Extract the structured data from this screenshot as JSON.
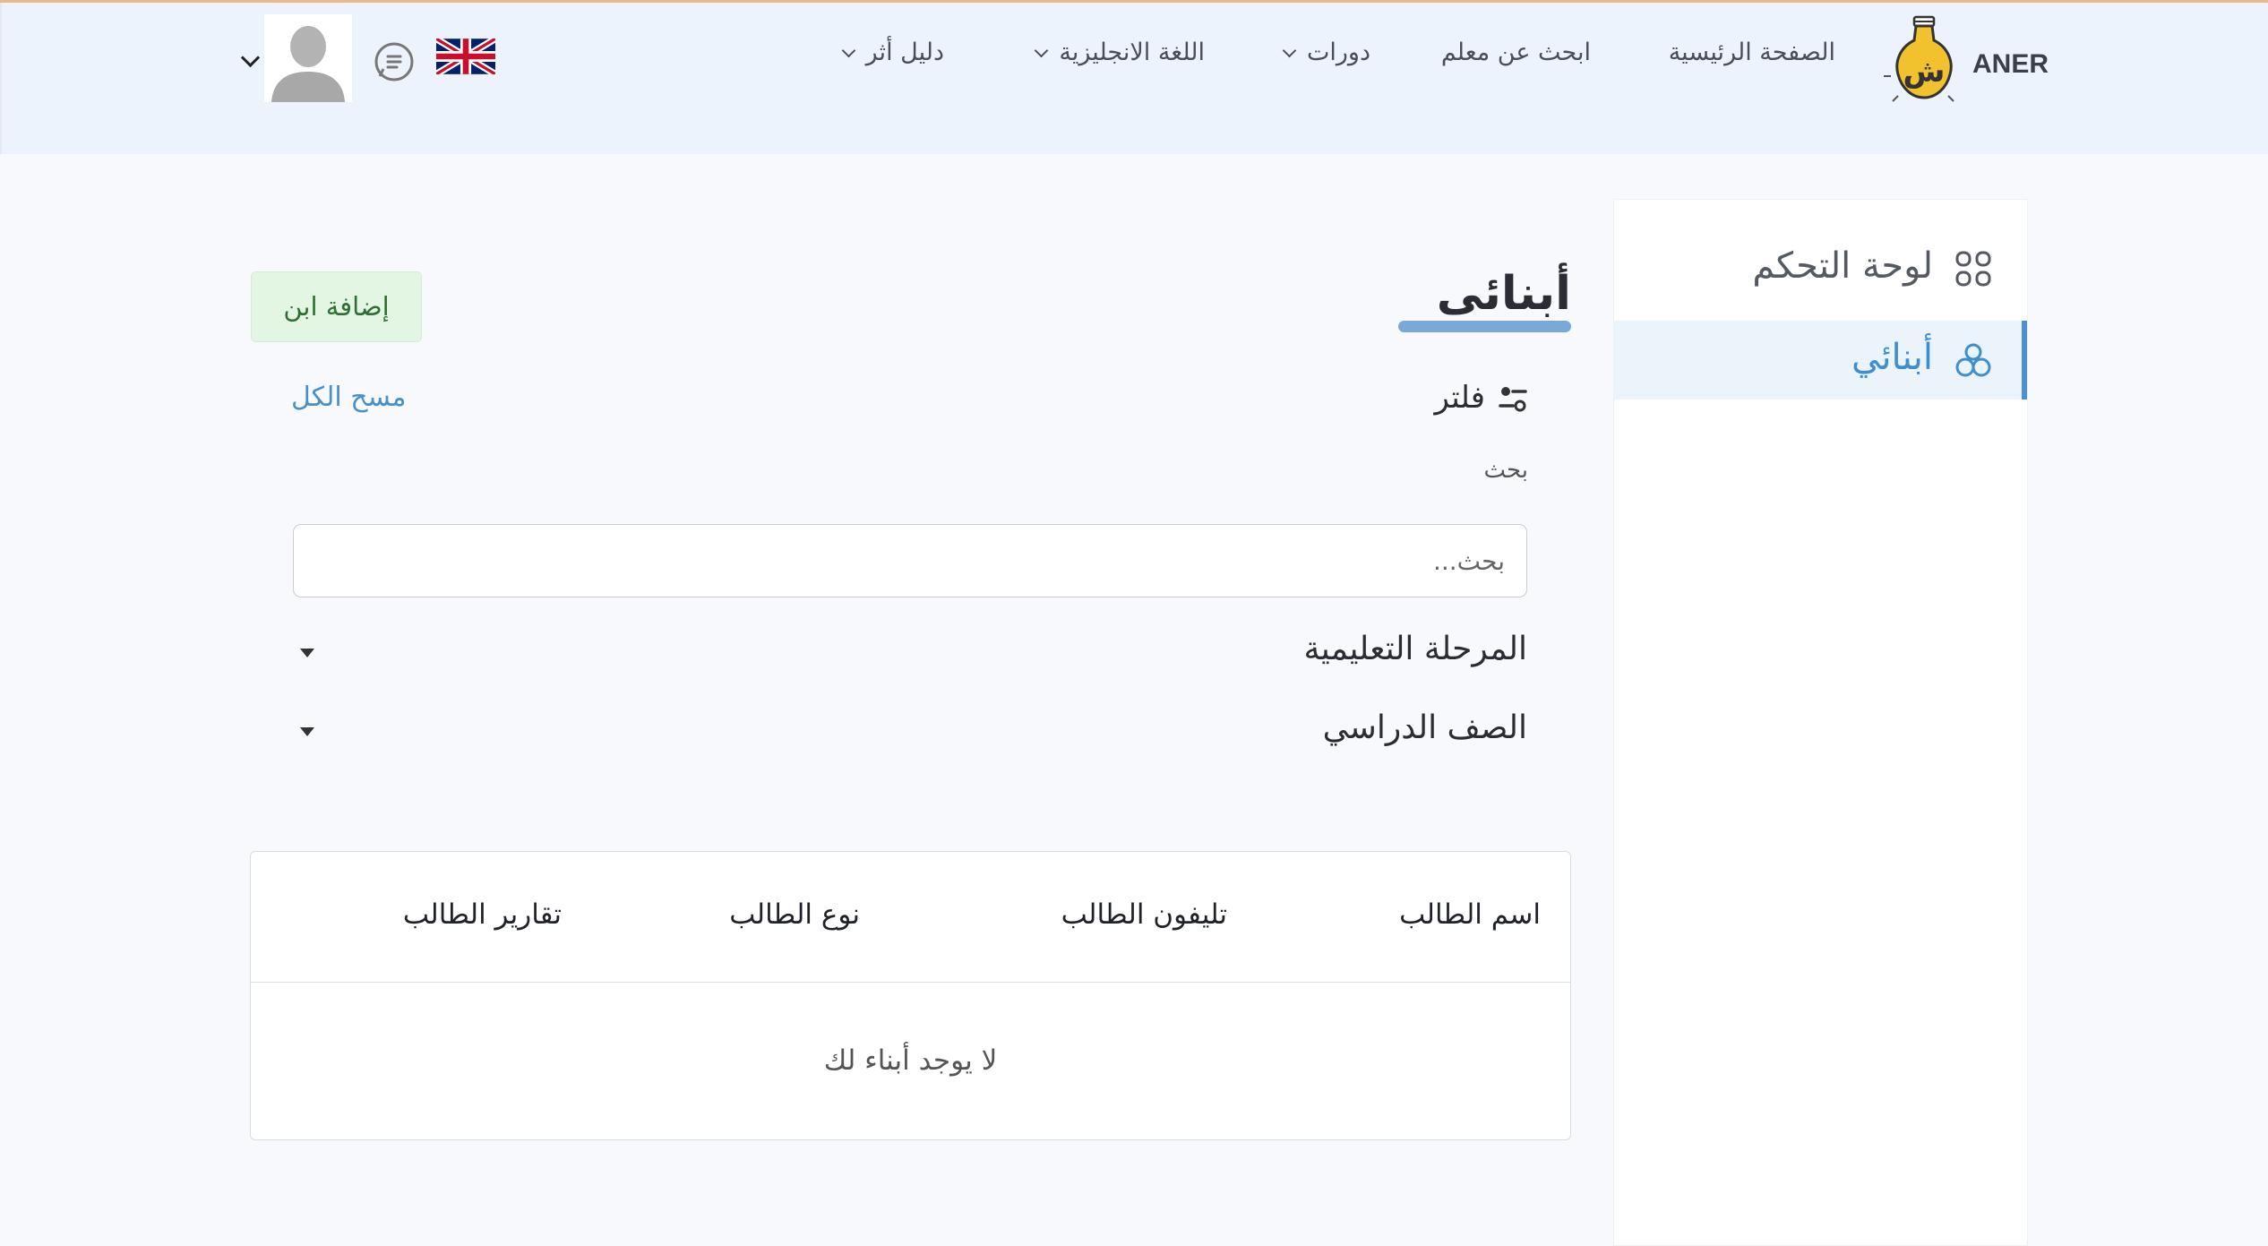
{
  "header": {
    "brand": "ANER",
    "nav": [
      {
        "label": "الصفحة الرئيسية",
        "dropdown": false
      },
      {
        "label": "ابحث عن معلم",
        "dropdown": false
      },
      {
        "label": "دورات",
        "dropdown": true
      },
      {
        "label": "اللغة الانجليزية",
        "dropdown": true
      },
      {
        "label": "دليل أثر",
        "dropdown": true
      }
    ],
    "language_flag": "uk-flag-icon",
    "messages_icon": "chat-icon",
    "avatar_icon": "user-avatar-icon"
  },
  "sidebar": {
    "items": [
      {
        "label": "لوحة التحكم",
        "icon": "dashboard-grid-icon",
        "active": false
      },
      {
        "label": "أبنائي",
        "icon": "children-icon",
        "active": true
      }
    ]
  },
  "main": {
    "title": "أبنائى",
    "add_button": "إضافة ابن",
    "filter": {
      "label": "فلتر",
      "clear_all": "مسح الكل",
      "search_label": "بحث",
      "search_placeholder": "بحث...",
      "dropdowns": [
        {
          "label": "المرحلة التعليمية"
        },
        {
          "label": "الصف الدراسي"
        }
      ]
    },
    "table": {
      "columns": [
        "اسم الطالب",
        "تليفون الطالب",
        "نوع الطالب",
        "تقارير الطالب"
      ],
      "empty_message": "لا يوجد أبناء لك"
    }
  },
  "colors": {
    "accent": "#4a90d9",
    "nav_bg": "#edf3fc",
    "add_button_bg": "#e3f6e3",
    "add_button_text": "#2e6e33",
    "brand_bulb": "#f2c12e"
  }
}
